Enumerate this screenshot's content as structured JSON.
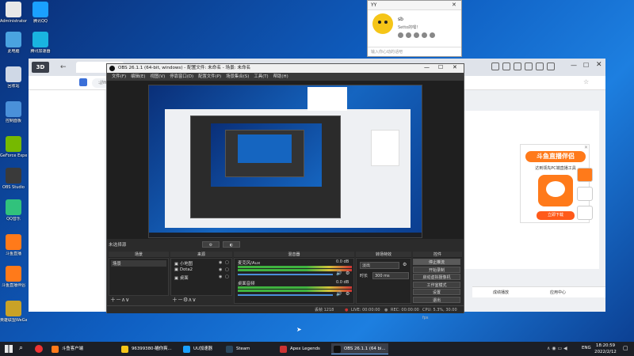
{
  "desktop_icons": [
    {
      "label": "Administrator",
      "color": "#e8e8e8"
    },
    {
      "label": "腾讯QQ",
      "color": "#1aa0ff"
    },
    {
      "label": "此电脑",
      "color": "#4aa3e0"
    },
    {
      "label": "腾讯加速器",
      "color": "#19b4e0"
    },
    {
      "label": "回收站",
      "color": "#cfd8e6"
    },
    {
      "label": "控制面板",
      "color": "#4a90d9"
    },
    {
      "label": "GeForce Experience",
      "color": "#76b900"
    },
    {
      "label": "OBS Studio",
      "color": "#3a3a3a"
    },
    {
      "label": "QQ音乐",
      "color": "#31c27c"
    },
    {
      "label": "斗鱼直播",
      "color": "#ff7a1a"
    },
    {
      "label": "斗鱼直播伴侣",
      "color": "#ff7a1a"
    },
    {
      "label": "英雄联盟WeGame版",
      "color": "#c9a227"
    }
  ],
  "browser": {
    "url": "://mp",
    "douyu_title": "斗鱼直播伴侣",
    "douyu_sub": "达到领先PC端直播工具",
    "douyu_download": "立即下载",
    "status_items": [
      "成绩播放",
      "应用中心"
    ]
  },
  "chat": {
    "title": "YY",
    "name": "sb",
    "status": "Setto的嘿！",
    "input_placeholder": "输入你心动的话吧"
  },
  "obs": {
    "title": "OBS 26.1.1 (64-bit, windows) - 配置文件: 未命名 - 场景: 未命名",
    "menu": [
      "文件(F)",
      "编辑(E)",
      "视图(V)",
      "停靠窗口(D)",
      "配置文件(P)",
      "场景集合(S)",
      "工具(T)",
      "帮助(H)"
    ],
    "no_source": "未选择源",
    "panels": {
      "scenes": "场景",
      "sources": "来源",
      "mixer": "混音器",
      "transitions": "转场特效",
      "controls": "控件"
    },
    "scene_item": "场景",
    "sources": [
      "小地图",
      "Dota2",
      "桌面"
    ],
    "mixer": [
      {
        "name": "麦克风/Aux",
        "db": "0.0 dB"
      },
      {
        "name": "桌面音频",
        "db": "0.0 dB"
      }
    ],
    "transition": {
      "type": "淡出",
      "duration_label": "时长",
      "duration": "300 ms"
    },
    "controls": [
      "停止推流",
      "开始录制",
      "启动虚拟摄像机",
      "工作室模式",
      "设置",
      "退出"
    ],
    "status": {
      "dropped": "丢帧 1218",
      "live": "LIVE: 00:00:00",
      "rec": "REC: 00:00:00",
      "cpu": "CPU: 5.3%, 30.00 fps"
    }
  },
  "taskbar": {
    "items": [
      {
        "label": "斗鱼客户端",
        "color": "#ff7a1a"
      },
      {
        "label": "96399380-瞄你爽...",
        "color": "#f5c518"
      },
      {
        "label": "UU加速器",
        "color": "#1aa0ff"
      },
      {
        "label": "Steam",
        "color": "#2a475e"
      },
      {
        "label": "Apex Legends",
        "color": "#c33"
      },
      {
        "label": "OBS 26.1.1 (64 bi...",
        "color": "#111"
      }
    ],
    "lang": "ENG",
    "time": "18:20:59",
    "date": "2022/2/12"
  }
}
